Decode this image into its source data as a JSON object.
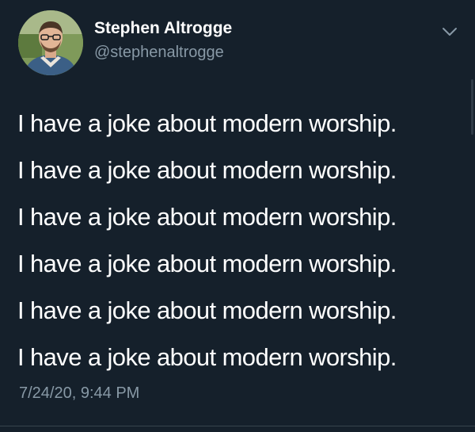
{
  "author": {
    "display_name": "Stephen Altrogge",
    "handle": "@stephenaltrogge",
    "avatar_icon": "profile-photo"
  },
  "menu": {
    "icon": "chevron-down-icon"
  },
  "tweet": {
    "lines": [
      "I have a joke about modern worship.",
      "I have a joke about modern worship.",
      "I have a joke about modern worship.",
      "I have a joke about modern worship.",
      "I have a joke about modern worship.",
      "I have a joke about modern worship."
    ],
    "timestamp": "7/24/20, 9:44 PM"
  },
  "colors": {
    "background": "#15202b",
    "primary_text": "#ffffff",
    "secondary_text": "#8899a6"
  }
}
